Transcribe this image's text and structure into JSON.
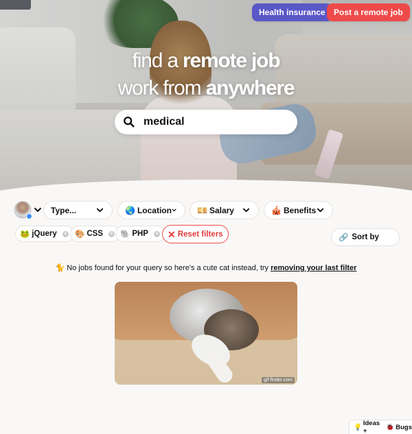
{
  "header": {
    "health_insurance_label": "Health insurance",
    "post_job_label": "Post a remote job",
    "colors": {
      "health": "#5a57c7",
      "post": "#ef4a4a"
    }
  },
  "hero": {
    "line1_thin": "find a ",
    "line1_bold": "remote job",
    "line2_thin": "work from ",
    "line2_bold": "anywhere"
  },
  "search": {
    "value": "medical",
    "icon": "search-icon"
  },
  "filters": {
    "type": {
      "icon": "",
      "label": "Type..."
    },
    "location": {
      "icon": "🌏",
      "label": "Location"
    },
    "salary": {
      "icon": "💴",
      "label": "Salary"
    },
    "benefits": {
      "icon": "🎪",
      "label": "Benefits"
    }
  },
  "tags": [
    {
      "icon": "🐸",
      "label": "jQuery"
    },
    {
      "icon": "🎨",
      "label": "CSS"
    },
    {
      "icon": "🐘",
      "label": "PHP"
    }
  ],
  "tag_remove_glyph": "×",
  "reset": {
    "icon": "✕",
    "label": "Reset filters"
  },
  "sort": {
    "icon": "🔗",
    "label": "Sort by"
  },
  "empty_state": {
    "icon": "🐈",
    "text": " No jobs found for your query so here's a cute cat instead, try ",
    "link": "removing your last filter"
  },
  "cat_gif": {
    "watermark": "gif-finder.com"
  },
  "feedback": {
    "icon_left": "💡",
    "label_left": " Ideas + ",
    "icon_right": "🐞",
    "label_right": " Bugs"
  }
}
